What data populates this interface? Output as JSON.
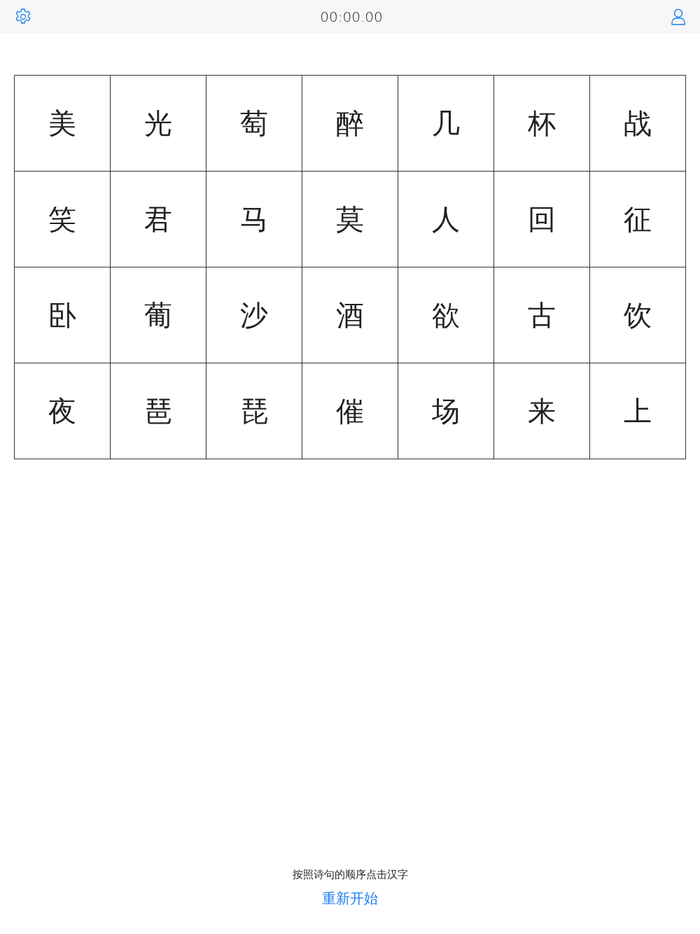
{
  "header": {
    "timer": "00:00.00"
  },
  "grid": {
    "rows": [
      [
        "美",
        "光",
        "萄",
        "醉",
        "几",
        "杯",
        "战"
      ],
      [
        "笑",
        "君",
        "马",
        "莫",
        "人",
        "回",
        "征"
      ],
      [
        "卧",
        "葡",
        "沙",
        "酒",
        "欲",
        "古",
        "饮"
      ],
      [
        "夜",
        "琶",
        "琵",
        "催",
        "场",
        "来",
        "上"
      ]
    ]
  },
  "instruction": "按照诗句的顺序点击汉字",
  "restart_button": "重新开始"
}
